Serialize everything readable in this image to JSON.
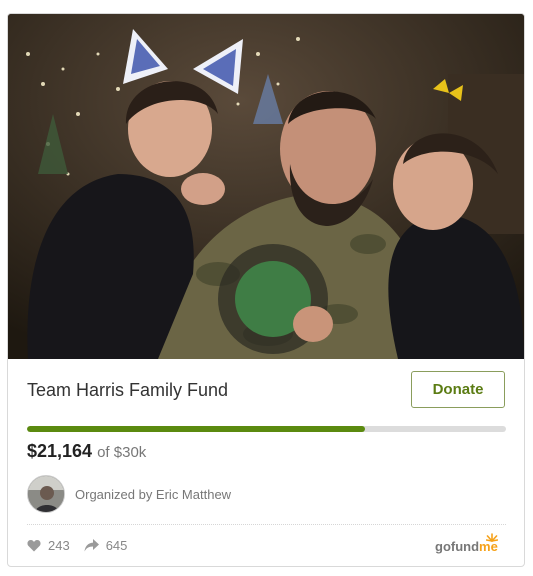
{
  "campaign": {
    "title": "Team Harris Family Fund",
    "donate_label": "Donate",
    "raised": "$21,164",
    "goal_text": "of $30k",
    "progress_fraction": 0.705,
    "organizer_text": "Organized by Eric Matthew"
  },
  "stats": {
    "likes": "243",
    "shares": "645",
    "heart_icon": "heart-icon",
    "share_icon": "share-arrow-icon"
  },
  "brand": {
    "logo_go": "gofund",
    "logo_me": "me",
    "accent": "#5b8a0f",
    "button_text_color": "#5b7c13",
    "logo_orange": "#f6a21a"
  }
}
